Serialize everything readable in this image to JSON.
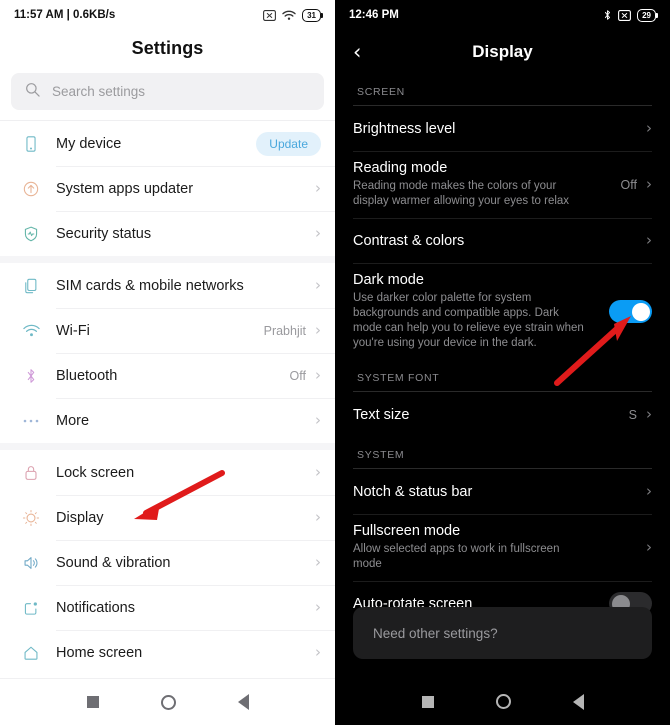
{
  "left": {
    "status_bar": {
      "time": "11:57 AM | 0.6KB/s",
      "battery": "31",
      "icons": [
        "no-sim-icon",
        "wifi-icon",
        "battery-icon"
      ]
    },
    "app_title": "Settings",
    "search": {
      "placeholder": "Search settings",
      "icon": "search-icon"
    },
    "groups": [
      {
        "items": [
          {
            "label": "My device",
            "icon": "phone-icon",
            "badge": "Update",
            "chevron": false
          },
          {
            "label": "System apps updater",
            "icon": "update-arrow-icon",
            "value": "",
            "chevron": true
          },
          {
            "label": "Security status",
            "icon": "shield-icon",
            "value": "",
            "chevron": true
          }
        ]
      },
      {
        "items": [
          {
            "label": "SIM cards & mobile networks",
            "icon": "sim-cards-icon",
            "value": "",
            "chevron": true
          },
          {
            "label": "Wi-Fi",
            "icon": "wifi-icon",
            "value": "Prabhjit",
            "chevron": true
          },
          {
            "label": "Bluetooth",
            "icon": "bluetooth-icon",
            "value": "Off",
            "chevron": true
          },
          {
            "label": "More",
            "icon": "more-dots-icon",
            "value": "",
            "chevron": true
          }
        ]
      },
      {
        "items": [
          {
            "label": "Lock screen",
            "icon": "lock-icon",
            "value": "",
            "chevron": true
          },
          {
            "label": "Display",
            "icon": "brightness-icon",
            "value": "",
            "chevron": true
          },
          {
            "label": "Sound & vibration",
            "icon": "speaker-icon",
            "value": "",
            "chevron": true
          },
          {
            "label": "Notifications",
            "icon": "notification-icon",
            "value": "",
            "chevron": true
          },
          {
            "label": "Home screen",
            "icon": "home-icon",
            "value": "",
            "chevron": true
          }
        ]
      }
    ],
    "nav": {
      "recents": "recents-square-icon",
      "home": "home-circle-icon",
      "back": "back-triangle-icon"
    }
  },
  "right": {
    "status_bar": {
      "time": "12:46 PM",
      "battery": "29",
      "icons": [
        "bluetooth-icon",
        "no-sim-icon",
        "battery-icon"
      ]
    },
    "header": {
      "back": "‹",
      "title": "Display"
    },
    "sections": [
      {
        "header": "SCREEN",
        "items": [
          {
            "title": "Brightness level",
            "subtitle": "",
            "value": "",
            "control": "chevron"
          },
          {
            "title": "Reading mode",
            "subtitle": "Reading mode makes the colors of your display warmer allowing your eyes to relax",
            "value": "Off",
            "control": "chevron"
          },
          {
            "title": "Contrast & colors",
            "subtitle": "",
            "value": "",
            "control": "chevron"
          },
          {
            "title": "Dark mode",
            "subtitle": "Use darker color palette for system backgrounds and compatible apps. Dark mode can help you to relieve eye strain when you're using your device in the dark.",
            "value": "",
            "control": "toggle-on"
          }
        ]
      },
      {
        "header": "SYSTEM FONT",
        "items": [
          {
            "title": "Text size",
            "subtitle": "",
            "value": "S",
            "control": "chevron"
          }
        ]
      },
      {
        "header": "SYSTEM",
        "items": [
          {
            "title": "Notch & status bar",
            "subtitle": "",
            "value": "",
            "control": "chevron"
          },
          {
            "title": "Fullscreen mode",
            "subtitle": "Allow selected apps to work in fullscreen mode",
            "value": "",
            "control": "chevron"
          },
          {
            "title": "Auto-rotate screen",
            "subtitle": "",
            "value": "",
            "control": "toggle-off"
          }
        ]
      }
    ],
    "need_other_settings": "Need other settings?",
    "nav": {
      "recents": "recents-square-icon",
      "home": "home-circle-icon",
      "back": "back-triangle-icon"
    }
  },
  "annotations": {
    "arrow_color": "#e01b1b",
    "left_arrow_target": "Display",
    "right_arrow_target": "Dark mode toggle"
  }
}
